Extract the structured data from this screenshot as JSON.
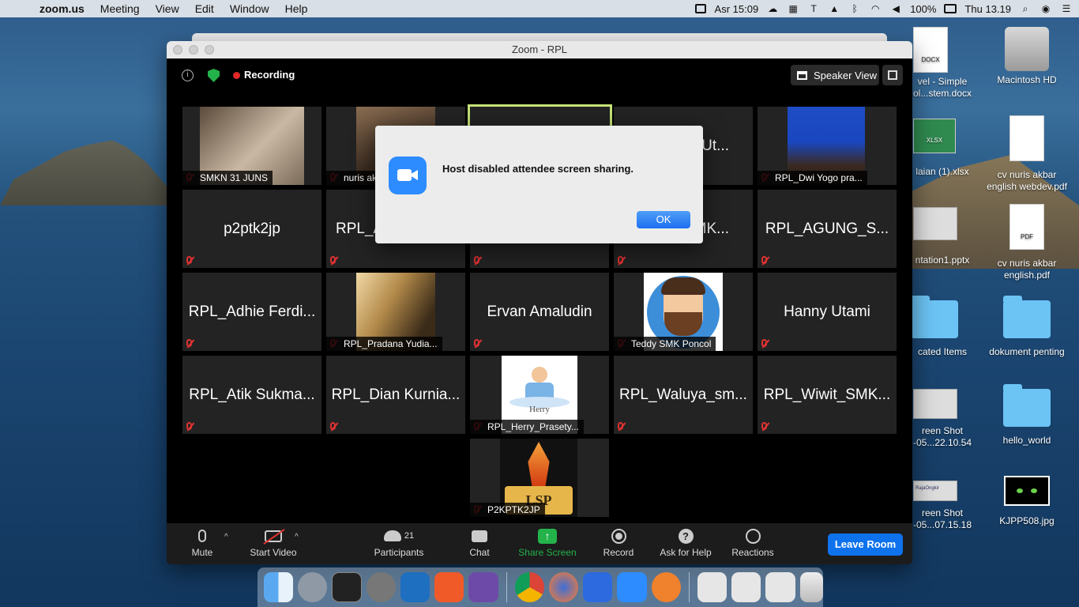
{
  "menubar": {
    "apple": "",
    "app_name": "zoom.us",
    "menus": [
      "Meeting",
      "View",
      "Edit",
      "Window",
      "Help"
    ],
    "prayer_time": "Asr 15:09",
    "battery": "100%",
    "clock": "Thu 13.19"
  },
  "desktop": {
    "icons": [
      {
        "label": "...vel - Simple\n...ol...stem.docx",
        "line1": "vel - Simple",
        "line2": "ol...stem.docx",
        "kind": "docx",
        "tag": "DOCX"
      },
      {
        "label": "Macintosh HD",
        "line1": "Macintosh HD",
        "line2": "",
        "kind": "drive",
        "tag": ""
      },
      {
        "line1": "laian (1).xlsx",
        "line2": "",
        "kind": "xlsx",
        "tag": "XLSX"
      },
      {
        "line1": "cv nuris akbar",
        "line2": "english webdev.pdf",
        "kind": "pdf",
        "tag": ""
      },
      {
        "line1": "ntation1.pptx",
        "line2": "",
        "kind": "pptx",
        "tag": ""
      },
      {
        "line1": "cv nuris akbar",
        "line2": "english.pdf",
        "kind": "pdf",
        "tag": "PDF"
      },
      {
        "line1": "cated Items",
        "line2": "",
        "kind": "folder",
        "tag": ""
      },
      {
        "line1": "dokument penting",
        "line2": "",
        "kind": "folder",
        "tag": ""
      },
      {
        "line1": "reen Shot",
        "line2": "-05...22.10.54",
        "kind": "screenshot",
        "tag": ""
      },
      {
        "line1": "hello_world",
        "line2": "",
        "kind": "folder",
        "tag": ""
      },
      {
        "line1": "reen Shot",
        "line2": "-05...07.15.18",
        "kind": "screenshot",
        "tag": "RajaOngkir"
      },
      {
        "line1": "KJPP508.jpg",
        "line2": "",
        "kind": "image",
        "tag": ""
      }
    ]
  },
  "zoom": {
    "window_title": "Zoom - RPL",
    "recording_label": "Recording",
    "speaker_view_label": "Speaker View",
    "tiles": [
      {
        "name": "SMKN 31 JUNS",
        "video": true
      },
      {
        "name": "nuris akbar",
        "video": true
      },
      {
        "name": "",
        "video": false
      },
      {
        "name": "di_Ut...",
        "video": false
      },
      {
        "name": "RPL_Dwi Yogo pra...",
        "video": true
      },
      {
        "name": "p2ptk2jp",
        "video": false
      },
      {
        "name": "RPL_A",
        "video": false
      },
      {
        "name": "SMK...",
        "video": false
      },
      {
        "name": "RPL_AGUNG_S...",
        "video": false
      },
      {
        "name": "RPL_Adhie Ferdi...",
        "video": false
      },
      {
        "name": "RPL_Pradana Yudia...",
        "video": true
      },
      {
        "name": "Ervan Amaludin",
        "video": false
      },
      {
        "name": "Teddy SMK Poncol",
        "video": true
      },
      {
        "name": "Hanny Utami",
        "video": false
      },
      {
        "name": "RPL_Atik Sukma...",
        "video": false
      },
      {
        "name": "RPL_Dian Kurnia...",
        "video": false
      },
      {
        "name": "RPL_Herry_Prasety...",
        "video": true,
        "photo_text": "Herry"
      },
      {
        "name": "RPL_Waluya_sm...",
        "video": false
      },
      {
        "name": "RPL_Wiwit_SMK...",
        "video": false
      },
      {
        "name": "P2KPTK2JP",
        "video": true,
        "photo_text": "LSP"
      }
    ],
    "dialog": {
      "message": "Host disabled attendee screen sharing.",
      "ok_label": "OK"
    },
    "toolbar": {
      "mute": "Mute",
      "start_video": "Start Video",
      "participants": "Participants",
      "participant_count": "21",
      "chat": "Chat",
      "share_screen": "Share Screen",
      "record": "Record",
      "ask_for_help": "Ask for Help",
      "reactions": "Reactions",
      "leave_room": "Leave Room"
    },
    "colors": {
      "share_green": "#23b34a",
      "leave_blue": "#0e72ed",
      "mute_red": "#e03232",
      "active_speaker_outline": "#c6e377"
    }
  }
}
